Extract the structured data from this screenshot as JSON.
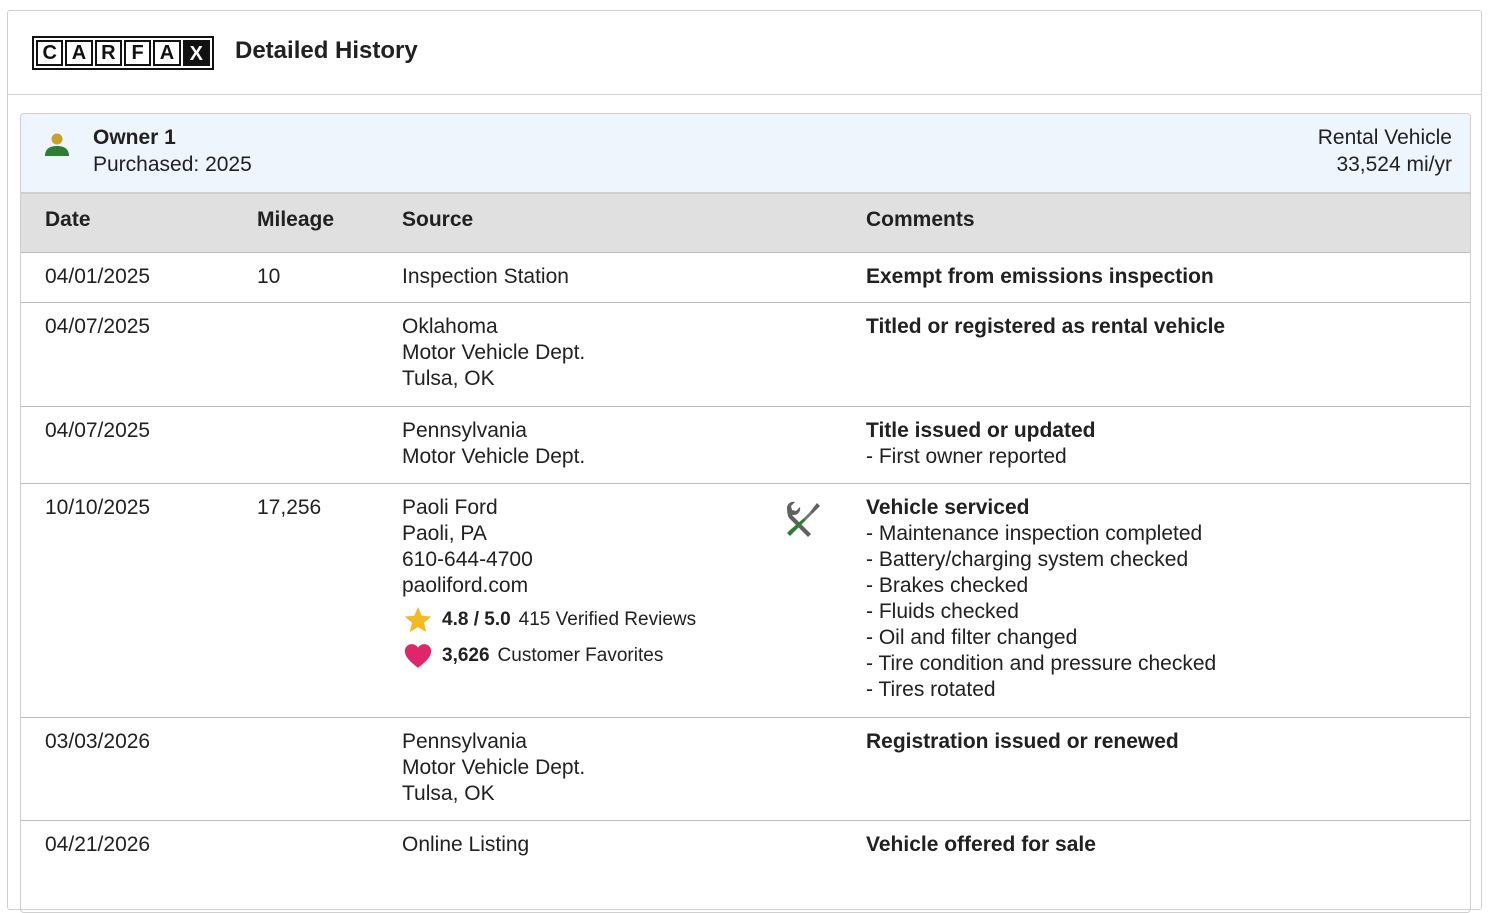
{
  "header": {
    "logo_letters": [
      "C",
      "A",
      "R",
      "F",
      "A",
      "X"
    ],
    "title": "Detailed History"
  },
  "owner": {
    "name": "Owner 1",
    "purchased": "Purchased: 2025",
    "type": "Rental Vehicle",
    "mileage": "33,524 mi/yr",
    "icon": "person-icon",
    "icon_color": "#2e7d32",
    "icon_head_color": "#c8a02a"
  },
  "table": {
    "columns": {
      "date": "Date",
      "mileage": "Mileage",
      "source": "Source",
      "comments": "Comments"
    },
    "rows": [
      {
        "date": "04/01/2025",
        "mileage": "10",
        "source": [
          "Inspection Station"
        ],
        "comment_title": "Exempt from emissions inspection",
        "comment_details": []
      },
      {
        "date": "04/07/2025",
        "mileage": "",
        "source": [
          "Oklahoma",
          "Motor Vehicle Dept.",
          "Tulsa, OK"
        ],
        "comment_title": "Titled or registered as rental vehicle",
        "comment_details": []
      },
      {
        "date": "04/07/2025",
        "mileage": "",
        "source": [
          "Pennsylvania",
          "Motor Vehicle Dept."
        ],
        "comment_title": "Title issued or updated",
        "comment_details": [
          "- First owner reported"
        ]
      },
      {
        "date": "10/10/2025",
        "mileage": "17,256",
        "source": [
          "Paoli Ford",
          "Paoli, PA",
          "610-644-4700",
          "paoliford.com"
        ],
        "rating": {
          "score": "4.8 / 5.0",
          "reviews": "415 Verified Reviews",
          "favorites": "3,626",
          "favorites_label": "Customer Favorites",
          "star_color": "#f5b921",
          "heart_color": "#e0266b"
        },
        "service_icon": "tools-icon",
        "comment_title": "Vehicle serviced",
        "comment_details": [
          "- Maintenance inspection completed",
          "- Battery/charging system checked",
          "- Brakes checked",
          "- Fluids checked",
          "- Oil and filter changed",
          "- Tire condition and pressure checked",
          "- Tires rotated"
        ]
      },
      {
        "date": "03/03/2026",
        "mileage": "",
        "source": [
          "Pennsylvania",
          "Motor Vehicle Dept.",
          "Tulsa, OK"
        ],
        "comment_title": "Registration issued or renewed",
        "comment_details": []
      },
      {
        "date": "04/21/2026",
        "mileage": "",
        "source": [
          "Online Listing"
        ],
        "comment_title": "Vehicle offered for sale",
        "comment_details": []
      }
    ]
  }
}
